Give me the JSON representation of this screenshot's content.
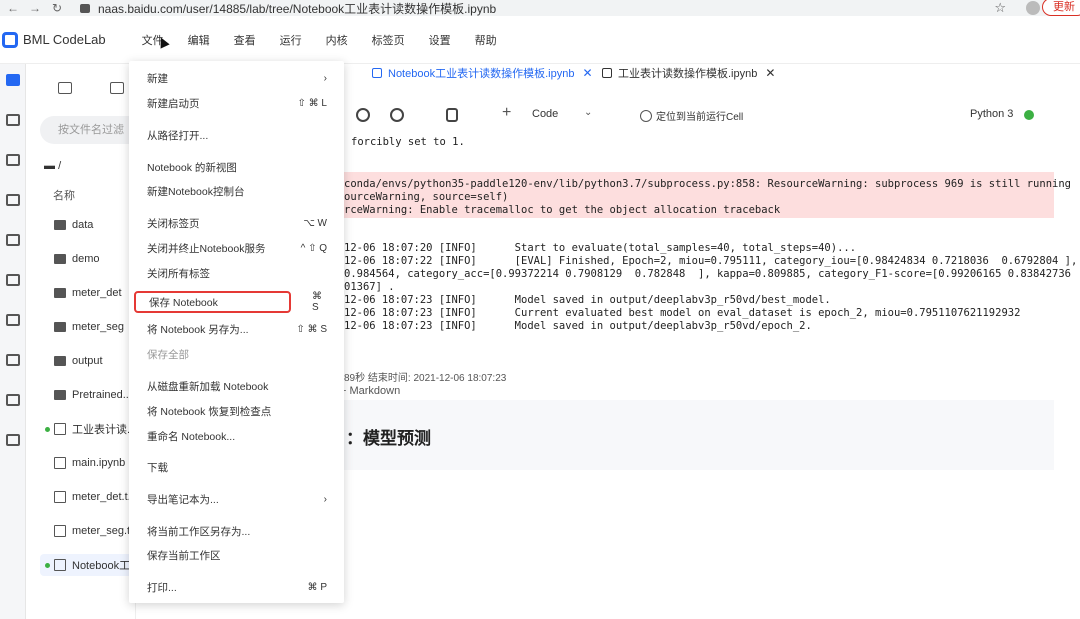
{
  "browser": {
    "url": "naas.baidu.com/user/14885/lab/tree/Notebook工业表计读数操作模板.ipynb",
    "update_label": "更新"
  },
  "app": {
    "name": "BML CodeLab",
    "menus": [
      "文件",
      "编辑",
      "查看",
      "运行",
      "内核",
      "标签页",
      "设置",
      "帮助"
    ]
  },
  "sidebar": {
    "search_placeholder": "按文件名过滤",
    "breadcrumb": "/",
    "column_header": "名称",
    "files": [
      {
        "name": "data",
        "kind": "folder"
      },
      {
        "name": "demo",
        "kind": "folder"
      },
      {
        "name": "meter_det",
        "kind": "folder"
      },
      {
        "name": "meter_seg",
        "kind": "folder"
      },
      {
        "name": "output",
        "kind": "folder"
      },
      {
        "name": "Pretrained...",
        "kind": "folder"
      },
      {
        "name": "工业表计读...",
        "kind": "notebook",
        "running": true
      },
      {
        "name": "main.ipynb",
        "kind": "notebook"
      },
      {
        "name": "meter_det.t...",
        "kind": "text"
      },
      {
        "name": "meter_seg.t...",
        "kind": "text"
      },
      {
        "name": "Notebook工...",
        "kind": "notebook",
        "running": true,
        "active": true
      }
    ]
  },
  "tabs": [
    {
      "label": "Notebook工业表计读数操作模板.ipynb",
      "active": true
    },
    {
      "label": "工业表计读数操作模板.ipynb",
      "active": false
    }
  ],
  "toolbar": {
    "cell_type": "Code",
    "locate_label": "定位到当前运行Cell",
    "kernel": "Python 3"
  },
  "output": {
    "lines": [
      "forcibly set to 1.",
      "conda/envs/python35-paddle120-env/lib/python3.7/subprocess.py:858: ResourceWarning: subprocess 969 is still running",
      "ourceWarning, source=self)",
      "rceWarning: Enable tracemalloc to get the object allocation traceback",
      "12-06 18:07:20 [INFO]      Start to evaluate(total_samples=40, total_steps=40)...",
      "12-06 18:07:22 [INFO]      [EVAL] Finished, Epoch=2, miou=0.795111, category_iou=[0.98424834 0.7218036  0.6792804 ],",
      "0.984564, category_acc=[0.99372214 0.7908129  0.782848  ], kappa=0.809885, category_F1-score=[0.99206165 0.83842736",
      "01367] .",
      "12-06 18:07:23 [INFO]      Model saved in output/deeplabv3p_r50vd/best_model.",
      "12-06 18:07:23 [INFO]      Current evaluated best model on eval_dataset is epoch_2, miou=0.7951107621192932",
      "12-06 18:07:23 [INFO]      Model saved in output/deeplabv3p_r50vd/epoch_2."
    ],
    "meta": "89秒   结束时间:  2021-12-06 18:07:23",
    "add_markdown": "+ Markdown",
    "md_heading": "：模型预测"
  },
  "file_menu": {
    "items": [
      {
        "label": "新建",
        "shortcut": "›"
      },
      {
        "label": "新建启动页",
        "shortcut": "⇧ ⌘ L"
      },
      {
        "label": "从路径打开...",
        "shortcut": ""
      },
      {
        "label": "Notebook 的新视图",
        "shortcut": ""
      },
      {
        "label": "新建Notebook控制台",
        "shortcut": ""
      },
      {
        "label": "关闭标签页",
        "shortcut": "⌥ W"
      },
      {
        "label": "关闭并终止Notebook服务",
        "shortcut": "^ ⇧ Q"
      },
      {
        "label": "关闭所有标签",
        "shortcut": ""
      },
      {
        "label": "保存 Notebook",
        "shortcut": "⌘ S"
      },
      {
        "label": "将 Notebook 另存为...",
        "shortcut": "⇧ ⌘ S"
      },
      {
        "label": "保存全部",
        "shortcut": ""
      },
      {
        "label": "从磁盘重新加载 Notebook",
        "shortcut": ""
      },
      {
        "label": "将 Notebook 恢复到检查点",
        "shortcut": ""
      },
      {
        "label": "重命名 Notebook...",
        "shortcut": ""
      },
      {
        "label": "下载",
        "shortcut": ""
      },
      {
        "label": "导出笔记本为...",
        "shortcut": "›"
      },
      {
        "label": "将当前工作区另存为...",
        "shortcut": ""
      },
      {
        "label": "保存当前工作区",
        "shortcut": ""
      },
      {
        "label": "打印...",
        "shortcut": "⌘ P"
      }
    ]
  }
}
